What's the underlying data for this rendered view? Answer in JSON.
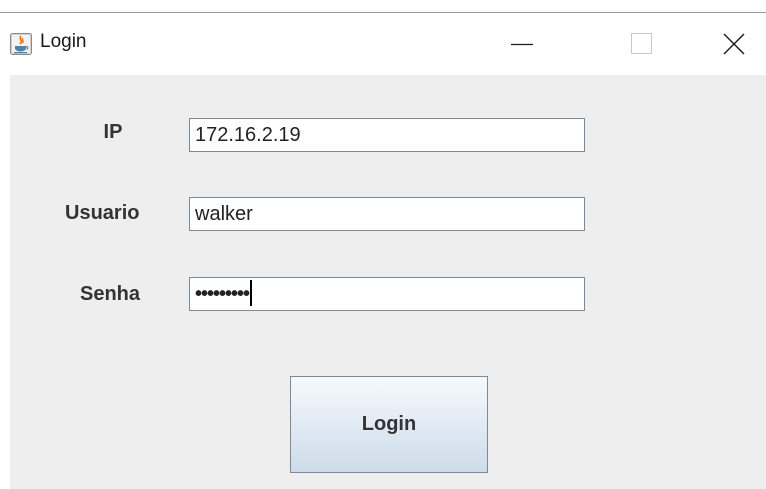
{
  "window": {
    "title": "Login",
    "icons": {
      "app": "java-coffee-cup-icon",
      "minimize": "minimize-icon",
      "maximize": "maximize-icon",
      "close": "close-icon"
    }
  },
  "form": {
    "ip": {
      "label": "IP",
      "value": "172.16.2.19"
    },
    "usuario": {
      "label": "Usuario",
      "value": "walker"
    },
    "senha": {
      "label": "Senha",
      "masked_value": "•••••••••"
    },
    "submit_label": "Login"
  },
  "colors": {
    "content_background": "#eeeeee",
    "field_border": "#7a8a99",
    "button_gradient_top": "#f6f9fc",
    "button_gradient_bottom": "#cddbe9"
  }
}
